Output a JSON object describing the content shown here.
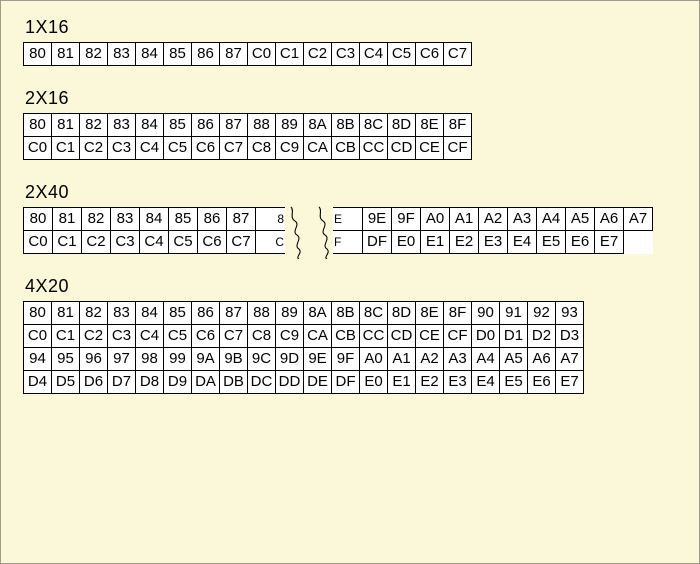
{
  "blocks": [
    {
      "title": "1X16",
      "type": "grid",
      "cols_class": "cols16",
      "rows": [
        [
          "80",
          "81",
          "82",
          "83",
          "84",
          "85",
          "86",
          "87",
          "C0",
          "C1",
          "C2",
          "C3",
          "C4",
          "C5",
          "C6",
          "C7"
        ]
      ]
    },
    {
      "title": "2X16",
      "type": "grid",
      "cols_class": "cols16",
      "rows": [
        [
          "80",
          "81",
          "82",
          "83",
          "84",
          "85",
          "86",
          "87",
          "88",
          "89",
          "8A",
          "8B",
          "8C",
          "8D",
          "8E",
          "8F"
        ],
        [
          "C0",
          "C1",
          "C2",
          "C3",
          "C4",
          "C5",
          "C6",
          "C7",
          "C8",
          "C9",
          "CA",
          "CB",
          "CC",
          "CD",
          "CE",
          "CF"
        ]
      ]
    },
    {
      "title": "2X40",
      "type": "torn",
      "left": {
        "rows": [
          [
            "80",
            "81",
            "82",
            "83",
            "84",
            "85",
            "86",
            "87",
            "8"
          ],
          [
            "C0",
            "C1",
            "C2",
            "C3",
            "C4",
            "C5",
            "C6",
            "C7",
            "C"
          ]
        ]
      },
      "right": {
        "rows": [
          [
            "E",
            "9E",
            "9F",
            "A0",
            "A1",
            "A2",
            "A3",
            "A4",
            "A5",
            "A6",
            "A7"
          ],
          [
            "F",
            "DF",
            "E0",
            "E1",
            "E2",
            "E3",
            "E4",
            "E5",
            "E6",
            "E7"
          ]
        ]
      }
    },
    {
      "title": "4X20",
      "type": "grid",
      "cols_class": "cols20",
      "rows": [
        [
          "80",
          "81",
          "82",
          "83",
          "84",
          "85",
          "86",
          "87",
          "88",
          "89",
          "8A",
          "8B",
          "8C",
          "8D",
          "8E",
          "8F",
          "90",
          "91",
          "92",
          "93"
        ],
        [
          "C0",
          "C1",
          "C2",
          "C3",
          "C4",
          "C5",
          "C6",
          "C7",
          "C8",
          "C9",
          "CA",
          "CB",
          "CC",
          "CD",
          "CE",
          "CF",
          "D0",
          "D1",
          "D2",
          "D3"
        ],
        [
          "94",
          "95",
          "96",
          "97",
          "98",
          "99",
          "9A",
          "9B",
          "9C",
          "9D",
          "9E",
          "9F",
          "A0",
          "A1",
          "A2",
          "A3",
          "A4",
          "A5",
          "A6",
          "A7"
        ],
        [
          "D4",
          "D5",
          "D6",
          "D7",
          "D8",
          "D9",
          "DA",
          "DB",
          "DC",
          "DD",
          "DE",
          "DF",
          "E0",
          "E1",
          "E2",
          "E3",
          "E4",
          "E5",
          "E6",
          "E7"
        ]
      ]
    }
  ]
}
